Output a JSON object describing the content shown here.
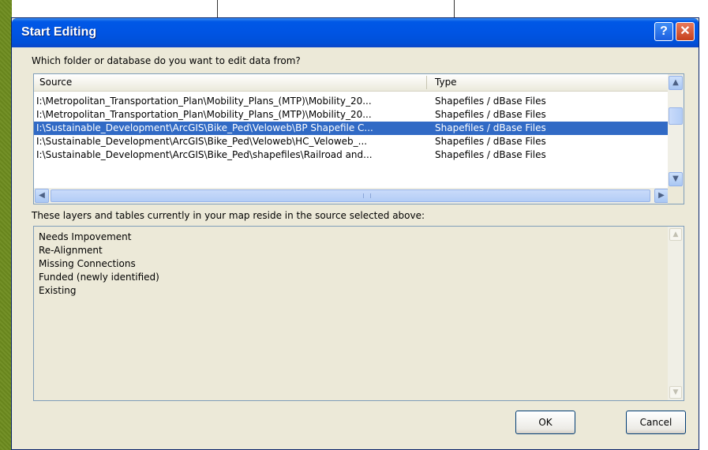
{
  "window": {
    "title": "Start Editing",
    "help_label": "?",
    "close_label": "✕"
  },
  "source_prompt": "Which folder or database do you want to edit data from?",
  "sources": {
    "columns": [
      "Source",
      "Type"
    ],
    "rows": [
      {
        "source": "I:\\Metropolitan_Transportation_Plan\\Mobility_Plans_(MTP)\\Mobility_20...",
        "type": "Shapefiles / dBase Files",
        "selected": false
      },
      {
        "source": "I:\\Metropolitan_Transportation_Plan\\Mobility_Plans_(MTP)\\Mobility_20...",
        "type": "Shapefiles / dBase Files",
        "selected": false
      },
      {
        "source": "I:\\Sustainable_Development\\ArcGIS\\Bike_Ped\\Veloweb\\BP Shapefile C...",
        "type": "Shapefiles / dBase Files",
        "selected": true
      },
      {
        "source": "I:\\Sustainable_Development\\ArcGIS\\Bike_Ped\\Veloweb\\HC_Veloweb_...",
        "type": "Shapefiles / dBase Files",
        "selected": false
      },
      {
        "source": "I:\\Sustainable_Development\\ArcGIS\\Bike_Ped\\shapefiles\\Railroad and...",
        "type": "Shapefiles / dBase Files",
        "selected": false
      }
    ]
  },
  "layers_prompt": "These layers and tables currently in your map reside in the source selected above:",
  "layers": [
    "Needs Impovement",
    "Re-Alignment",
    "Missing Connections",
    "Funded (newly identified)",
    "Existing"
  ],
  "buttons": {
    "ok": "OK",
    "cancel": "Cancel"
  },
  "icons": {
    "up_arrow": "▲",
    "down_arrow": "▼",
    "left_arrow": "◀",
    "right_arrow": "▶"
  },
  "colors": {
    "titlebar": "#0054e3",
    "selection": "#316ac5",
    "dialog_bg": "#ece9d8",
    "desktop_border": "#6e8d1f"
  }
}
